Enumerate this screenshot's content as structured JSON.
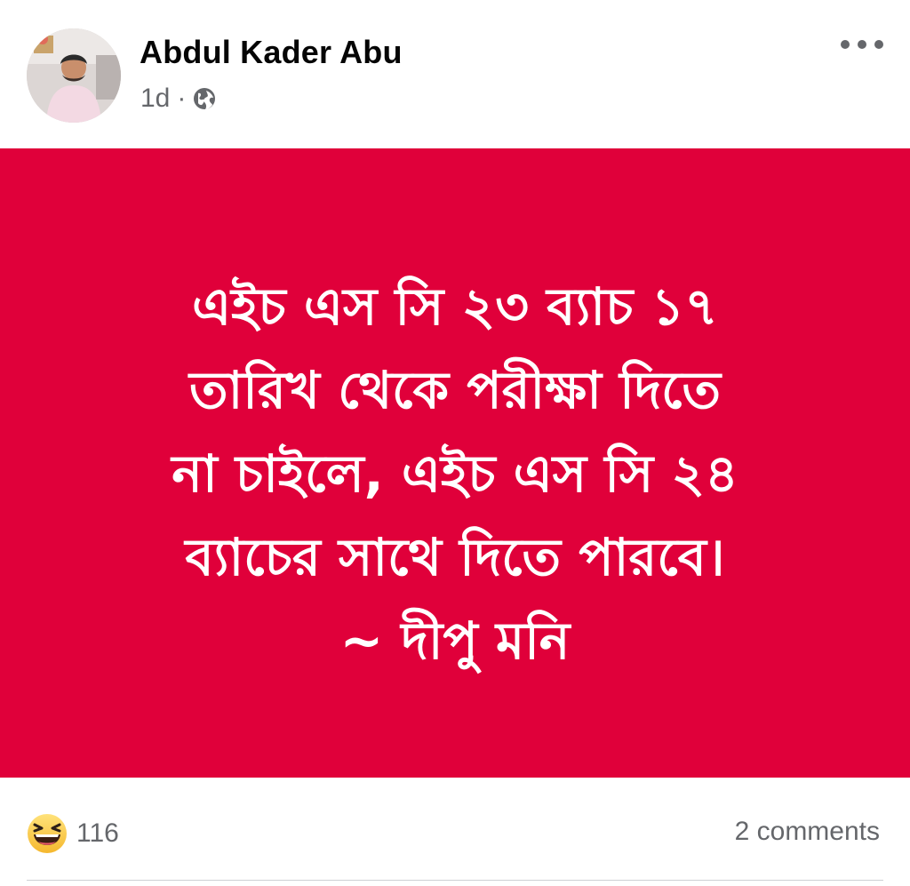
{
  "post": {
    "author": {
      "name": "Abdul Kader Abu",
      "avatar_icon": "profile-photo"
    },
    "timestamp": "1d",
    "separator": "·",
    "privacy_icon": "globe-icon",
    "more_icon": "more-options-icon",
    "body": {
      "background_color": "#e0003a",
      "text_color": "#ffffff",
      "lines": [
        "এইচ এস সি ২৩ ব্যাচ ১৭",
        "তারিখ থেকে পরীক্ষা দিতে",
        "না চাইলে, এইচ এস সি ২৪",
        "ব্যাচের সাথে দিতে পারবে।"
      ],
      "attribution": "~ দীপু মনি"
    },
    "reactions": {
      "icon": "haha-reaction-icon",
      "count": "116"
    },
    "comments_label": "2 comments"
  }
}
